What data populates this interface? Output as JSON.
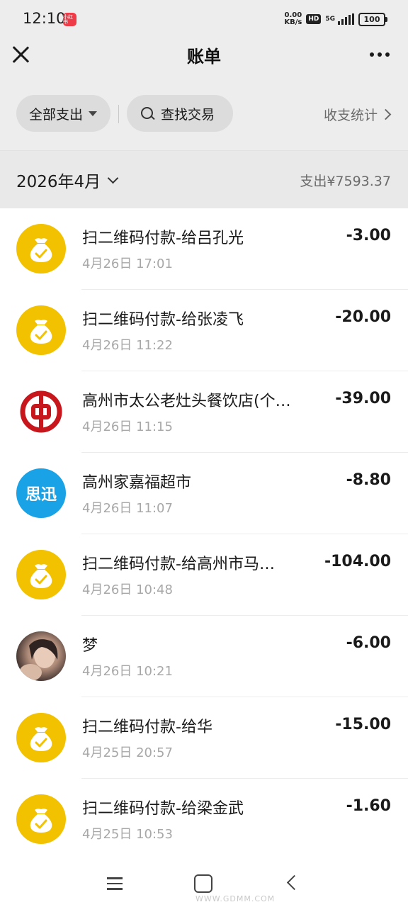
{
  "status_bar": {
    "time": "12:10",
    "app_badge": "小红书",
    "net_speed_value": "0.00",
    "net_speed_unit": "KB/s",
    "hd": "HD",
    "network": "5G",
    "battery": "100"
  },
  "nav": {
    "title": "账单"
  },
  "filters": {
    "all_label": "全部支出",
    "search_label": "查找交易",
    "stats_label": "收支统计"
  },
  "month": {
    "label": "2026年4月",
    "total": "支出¥7593.37"
  },
  "transactions": [
    {
      "icon": "money-bag-icon",
      "title": "扫二维码付款-给吕孔光",
      "time": "4月26日 17:01",
      "amount": "-3.00"
    },
    {
      "icon": "money-bag-icon",
      "title": "扫二维码付款-给张凌飞",
      "time": "4月26日 11:22",
      "amount": "-20.00"
    },
    {
      "icon": "bank-of-china-logo",
      "title": "高州市太公老灶头餐饮店(个…",
      "time": "4月26日 11:15",
      "amount": "-39.00"
    },
    {
      "icon": "sixun-logo",
      "logo_text": "思迅",
      "title": "高州家嘉福超市",
      "time": "4月26日 11:07",
      "amount": "-8.80"
    },
    {
      "icon": "money-bag-icon",
      "title": "扫二维码付款-给高州市马…",
      "time": "4月26日 10:48",
      "amount": "-104.00"
    },
    {
      "icon": "user-avatar-photo",
      "title": "梦",
      "time": "4月26日 10:21",
      "amount": "-6.00"
    },
    {
      "icon": "money-bag-icon",
      "title": "扫二维码付款-给华",
      "time": "4月25日 20:57",
      "amount": "-15.00"
    },
    {
      "icon": "money-bag-icon",
      "title": "扫二维码付款-给梁金武",
      "time": "4月25日 10:53",
      "amount": "-1.60"
    }
  ],
  "watermark": "WWW.GDMM.COM",
  "colors": {
    "page_bg": "#ededed",
    "list_bg": "#ffffff",
    "money_bag_yellow": "#f2c200",
    "boc_red": "#c8161d",
    "sixun_blue": "#1aa2e6",
    "muted_text": "#a8a8a8"
  }
}
